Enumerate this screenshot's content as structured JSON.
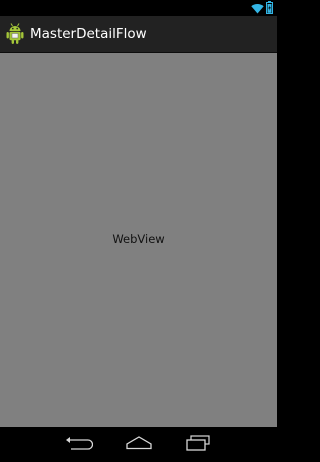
{
  "action_bar": {
    "title": "MasterDetailFlow",
    "app_icon": "android-robot-icon"
  },
  "content": {
    "label": "WebView"
  },
  "status_bar": {
    "icons": [
      "wifi-icon",
      "battery-icon"
    ]
  },
  "nav_bar": {
    "buttons": [
      "back-icon",
      "home-icon",
      "recent-apps-icon"
    ]
  },
  "colors": {
    "action_bar_bg": "#222222",
    "content_bg": "#808080",
    "status_accent": "#33b5e5",
    "app_icon_green": "#a4c639"
  }
}
